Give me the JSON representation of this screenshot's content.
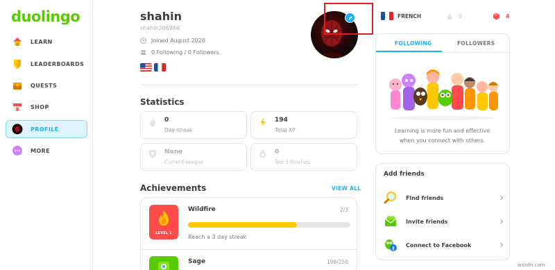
{
  "app": {
    "logo_text": "duolingo",
    "brand_color": "#58cc02",
    "accent_color": "#1cb0f6"
  },
  "sidebar": {
    "items": [
      {
        "label": "LEARN",
        "icon": "home-icon",
        "active": false
      },
      {
        "label": "LEADERBOARDS",
        "icon": "shield-icon",
        "active": false
      },
      {
        "label": "QUESTS",
        "icon": "treasure-chest-icon",
        "active": false
      },
      {
        "label": "SHOP",
        "icon": "shop-icon",
        "active": false
      },
      {
        "label": "PROFILE",
        "icon": "avatar-icon",
        "active": true
      },
      {
        "label": "MORE",
        "icon": "more-dots-icon",
        "active": false
      }
    ]
  },
  "profile": {
    "name": "shahin",
    "username": "shahin206966",
    "joined": "Joined August 2020",
    "follow_counts": "0 Following / 0 Followers",
    "flags": [
      "us-flag-icon",
      "france-flag-icon"
    ],
    "avatar_icon": "spiderman-avatar-icon",
    "edit_icon": "pencil-icon"
  },
  "statistics": {
    "title": "Statistics",
    "cards": [
      {
        "value": "0",
        "label": "Day streak",
        "icon": "flame-icon",
        "dim": false
      },
      {
        "value": "194",
        "label": "Total XP",
        "icon": "lightning-icon",
        "dim": false
      },
      {
        "value": "None",
        "label": "Current league",
        "icon": "shield-icon",
        "dim": true
      },
      {
        "value": "0",
        "label": "Top 3 finishes",
        "icon": "medal-icon",
        "dim": true
      }
    ]
  },
  "achievements": {
    "title": "Achievements",
    "view_all": "VIEW ALL",
    "items": [
      {
        "name": "Wildfire",
        "progress_text": "2/3",
        "progress": 0.67,
        "description": "Reach a 3 day streak",
        "badge_level": "LEVEL 1",
        "badge_icon": "fire-badge-icon"
      },
      {
        "name": "Sage",
        "progress_text": "196/250",
        "progress": 0.784,
        "description": "",
        "badge_level": "",
        "badge_icon": "sage-badge-icon"
      }
    ]
  },
  "topbar": {
    "course": "FRENCH",
    "course_flag": "france-flag-icon",
    "streak": "0",
    "streak_icon": "flame-icon",
    "gems": "4",
    "gems_icon": "gem-icon"
  },
  "follow_panel": {
    "tabs": [
      "FOLLOWING",
      "FOLLOWERS"
    ],
    "active_tab": "FOLLOWING",
    "promo_line1": "Learning is more fun and effective",
    "promo_line2": "when you connect with others.",
    "illustration": "characters-group-illustration"
  },
  "add_friends": {
    "title": "Add friends",
    "items": [
      {
        "label": "Find friends",
        "icon": "magnifier-icon"
      },
      {
        "label": "Invite friends",
        "icon": "envelope-icon"
      },
      {
        "label": "Connect to Facebook",
        "icon": "facebook-icon"
      }
    ]
  },
  "watermark": "wsxdn.com"
}
